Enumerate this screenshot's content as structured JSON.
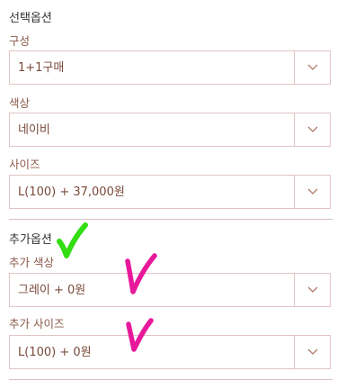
{
  "options": {
    "title": "선택옵션",
    "fields": [
      {
        "label": "구성",
        "value": "1+1구매"
      },
      {
        "label": "색상",
        "value": "네이비"
      },
      {
        "label": "사이즈",
        "value": "L(100)  + 37,000원"
      }
    ]
  },
  "extra_options": {
    "title": "추가옵션",
    "fields": [
      {
        "label": "추가 색상",
        "value": "그레이  + 0원"
      },
      {
        "label": "추가 사이즈",
        "value": "L(100)  + 0원"
      }
    ]
  },
  "annotations": {
    "green_check_color": "#33dd11",
    "pink_check_color": "#e8189a"
  }
}
